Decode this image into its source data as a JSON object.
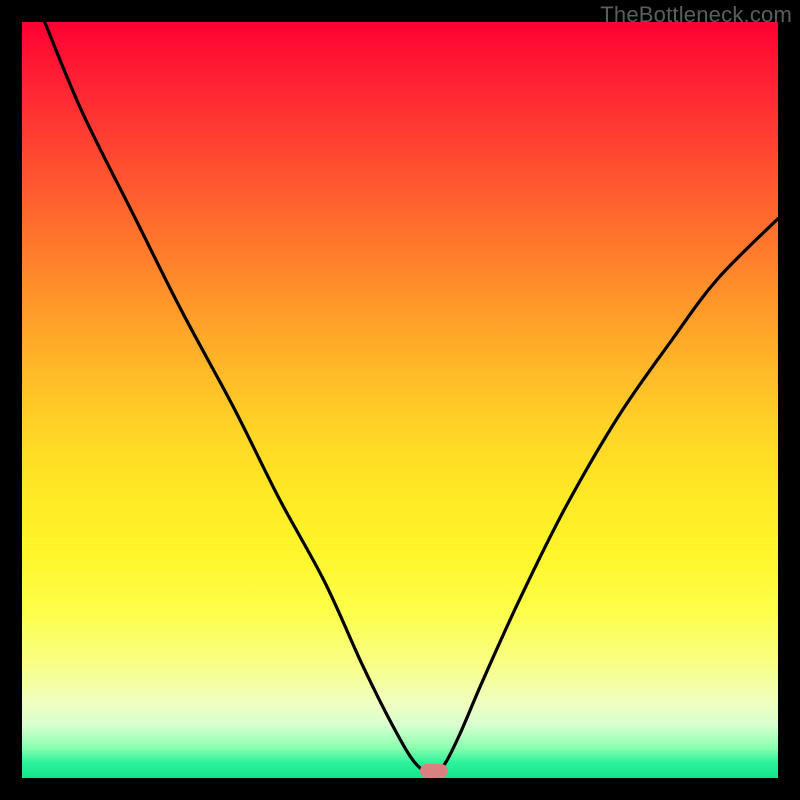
{
  "watermark": "TheBottleneck.com",
  "chart_data": {
    "type": "line",
    "title": "",
    "xlabel": "",
    "ylabel": "",
    "xlim": [
      0,
      100
    ],
    "ylim": [
      0,
      100
    ],
    "grid": false,
    "legend": false,
    "series": [
      {
        "name": "curve",
        "x": [
          3,
          8,
          15,
          21,
          28,
          34,
          40,
          45,
          49,
          52,
          54.5,
          56,
          58,
          61,
          66,
          72,
          79,
          86,
          92,
          100
        ],
        "y": [
          100,
          88,
          74,
          62,
          49,
          37,
          26,
          15,
          7,
          2,
          0.5,
          2,
          6,
          13,
          24,
          36,
          48,
          58,
          66,
          74
        ]
      }
    ],
    "marker": {
      "x": 54.5,
      "y": 0.9,
      "color": "#d98181"
    },
    "gradient_stops": [
      {
        "pos": 0,
        "color": "#ff0033"
      },
      {
        "pos": 50,
        "color": "#ffcc26"
      },
      {
        "pos": 80,
        "color": "#fcff60"
      },
      {
        "pos": 100,
        "color": "#14e68c"
      }
    ]
  }
}
